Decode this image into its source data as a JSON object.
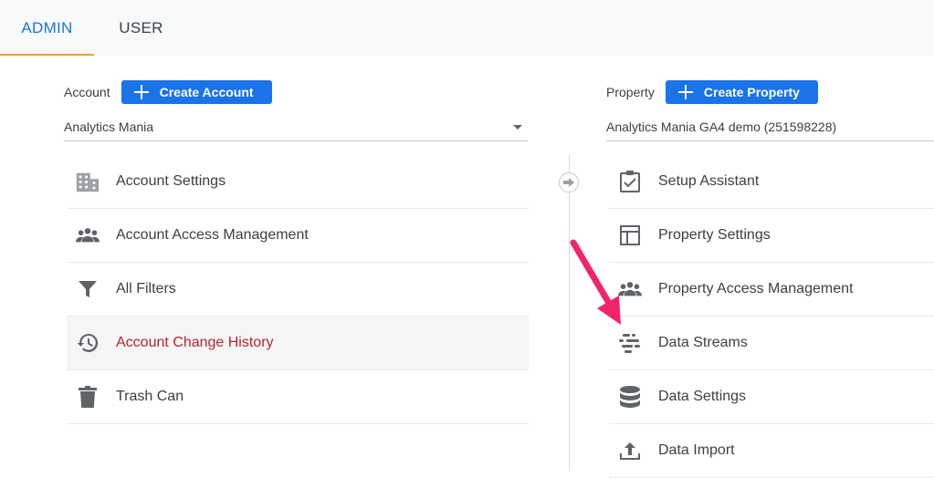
{
  "tabs": [
    {
      "label": "ADMIN"
    },
    {
      "label": "USER"
    }
  ],
  "account": {
    "label": "Account",
    "create_label": "Create Account",
    "selected": "Analytics Mania",
    "items": [
      {
        "label": "Account Settings",
        "icon": "building-icon"
      },
      {
        "label": "Account Access Management",
        "icon": "people-icon"
      },
      {
        "label": "All Filters",
        "icon": "filter-icon"
      },
      {
        "label": "Account Change History",
        "icon": "history-icon",
        "active": true
      },
      {
        "label": "Trash Can",
        "icon": "trash-icon"
      }
    ]
  },
  "property": {
    "label": "Property",
    "create_label": "Create Property",
    "selected": "Analytics Mania GA4 demo (251598228)",
    "items": [
      {
        "label": "Setup Assistant",
        "icon": "checklist-icon"
      },
      {
        "label": "Property Settings",
        "icon": "layout-icon"
      },
      {
        "label": "Property Access Management",
        "icon": "people-icon"
      },
      {
        "label": "Data Streams",
        "icon": "streams-icon"
      },
      {
        "label": "Data Settings",
        "icon": "database-icon"
      },
      {
        "label": "Data Import",
        "icon": "upload-icon"
      }
    ]
  },
  "colors": {
    "accent": "#1a73e8",
    "active_text": "#b3262e",
    "tab_underline": "#e8a33c",
    "annotation_arrow": "#f0256a",
    "icon": "#5f6368"
  }
}
